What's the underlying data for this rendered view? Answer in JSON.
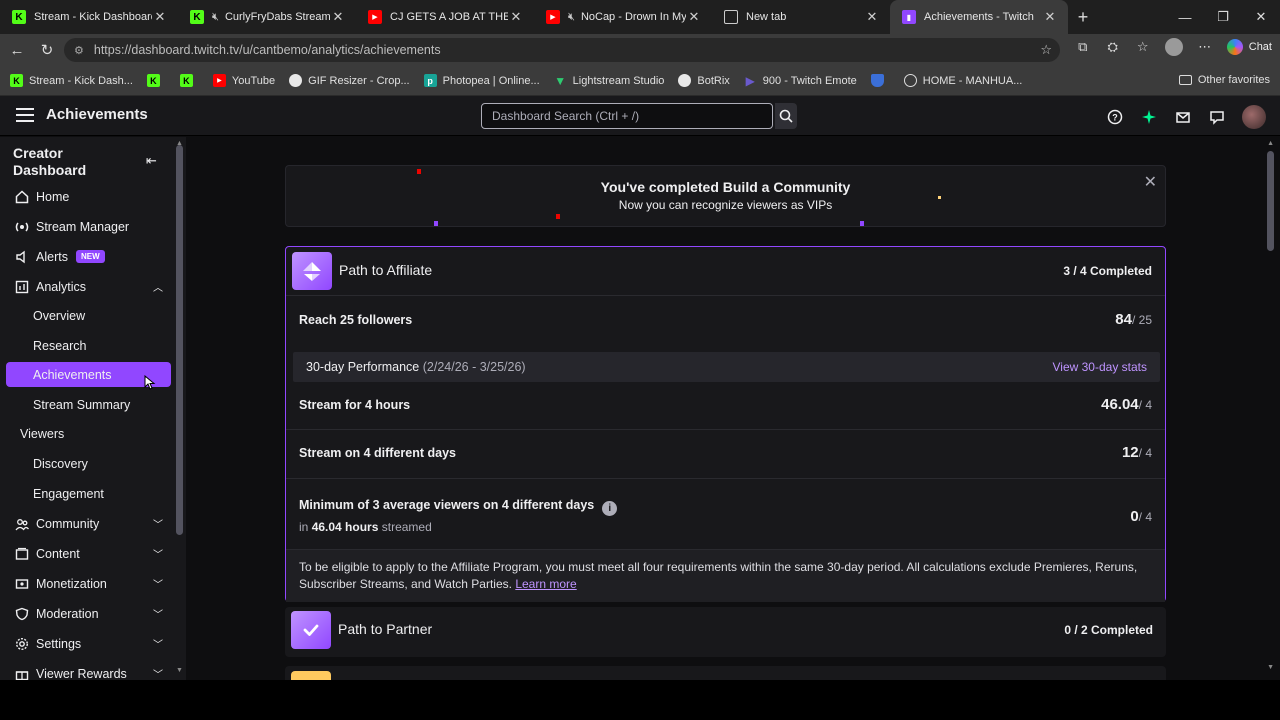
{
  "tabs": [
    {
      "title": "Stream - Kick Dashboard",
      "icon": "kick-icon",
      "color": "#53fc18"
    },
    {
      "title": "CurlyFryDabs Stream - W",
      "icon": "kick-icon",
      "color": "#53fc18",
      "muted": true
    },
    {
      "title": "CJ GETS A JOB AT THE DEALE",
      "icon": "youtube-icon",
      "color": "#ff0000"
    },
    {
      "title": "NoCap - Drown In My St",
      "icon": "youtube-icon",
      "color": "#ff0000",
      "muted": true
    },
    {
      "title": "New tab",
      "icon": "newtab-icon",
      "color": "#cccccc"
    },
    {
      "title": "Achievements - Twitch",
      "icon": "twitch-icon",
      "color": "#9147ff",
      "active": true
    }
  ],
  "address": {
    "url": "https://dashboard.twitch.tv/u/cantbemo/analytics/achievements",
    "chat_label": "Chat"
  },
  "bookmarks": [
    {
      "label": "Stream - Kick Dash...",
      "icon": "kick-icon",
      "color": "#53fc18"
    },
    {
      "label": "",
      "icon": "kick-icon",
      "color": "#53fc18"
    },
    {
      "label": "",
      "icon": "kick-icon",
      "color": "#53fc18"
    },
    {
      "label": "YouTube",
      "icon": "youtube-icon",
      "color": "#ff0000"
    },
    {
      "label": "GIF Resizer - Crop...",
      "icon": "gif-icon",
      "color": "#e8e8e8"
    },
    {
      "label": "Photopea | Online...",
      "icon": "photopea-icon",
      "color": "#18a497"
    },
    {
      "label": "Lightstream Studio",
      "icon": "lightstream-icon",
      "color": "#2ecc71"
    },
    {
      "label": "BotRix",
      "icon": "botrix-icon",
      "color": "#e8e8e8"
    },
    {
      "label": "900 - Twitch Emote",
      "icon": "emote-icon",
      "color": "#6a5acd"
    },
    {
      "label": "",
      "icon": "shield-icon",
      "color": "#3b6fd8"
    },
    {
      "label": "HOME - MANHUA...",
      "icon": "globe-icon",
      "color": "#e8e8e8"
    }
  ],
  "bookmarks_other": "Other favorites",
  "topnav": {
    "title": "Achievements",
    "search_placeholder": "Dashboard Search (Ctrl + /)"
  },
  "sidebar": {
    "title": "Creator Dashboard",
    "items": [
      {
        "label": "Home",
        "icon": "home-icon"
      },
      {
        "label": "Stream Manager",
        "icon": "stream-manager-icon"
      },
      {
        "label": "Alerts",
        "icon": "alerts-icon",
        "badge": "NEW"
      },
      {
        "label": "Analytics",
        "icon": "analytics-icon",
        "expanded": true
      },
      {
        "label": "Overview"
      },
      {
        "label": "Research"
      },
      {
        "label": "Achievements",
        "active": true
      },
      {
        "label": "Stream Summary"
      },
      {
        "label": "Viewers"
      },
      {
        "label": "Discovery"
      },
      {
        "label": "Engagement"
      },
      {
        "label": "Community",
        "icon": "community-icon"
      },
      {
        "label": "Content",
        "icon": "content-icon"
      },
      {
        "label": "Monetization",
        "icon": "monetization-icon"
      },
      {
        "label": "Moderation",
        "icon": "moderation-icon"
      },
      {
        "label": "Settings",
        "icon": "settings-icon"
      },
      {
        "label": "Viewer Rewards",
        "icon": "rewards-icon"
      }
    ]
  },
  "toast": {
    "heading": "You've completed Build a Community",
    "subtext": "Now you can recognize viewers as VIPs"
  },
  "affiliate": {
    "title": "Path to Affiliate",
    "completed": "3 / 4 Completed",
    "followers": {
      "label": "Reach 25 followers",
      "value": "84",
      "goal": "/ 25"
    },
    "performance": {
      "label": "30-day Performance",
      "dates": "(2/24/26 - 3/25/26)",
      "link": "View 30-day stats"
    },
    "hours": {
      "label": "Stream for 4 hours",
      "value": "46.04",
      "goal": "/ 4"
    },
    "days": {
      "label": "Stream on 4 different days",
      "value": "12",
      "goal": "/ 4"
    },
    "viewers": {
      "label": "Minimum of 3 average viewers on 4 different days",
      "value": "0",
      "goal": "/ 4",
      "sub_prefix": "in",
      "sub_hours": "46.04 hours",
      "sub_suffix": "streamed"
    },
    "note": "To be eligible to apply to the Affiliate Program, you must meet all four requirements within the same 30-day period. All calculations exclude Premieres, Reruns, Subscriber Streams, and Watch Parties.",
    "note_link": "Learn more"
  },
  "partner": {
    "title": "Path to Partner",
    "completed": "0 / 2 Completed"
  }
}
